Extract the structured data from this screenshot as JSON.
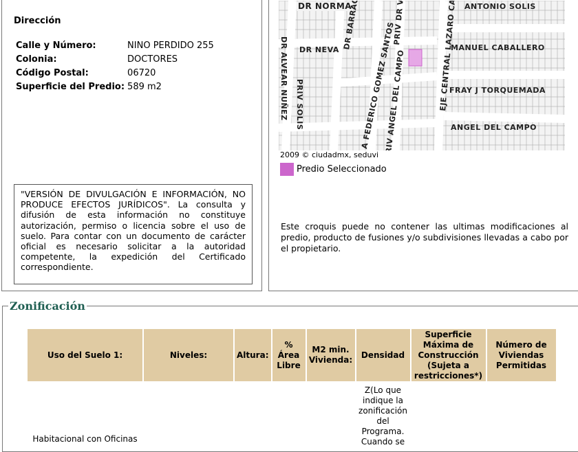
{
  "direccion": {
    "heading": "Dirección",
    "rows": [
      {
        "label": "Calle y Número:",
        "value": "NINO PERDIDO 255"
      },
      {
        "label": "Colonia:",
        "value": "DOCTORES"
      },
      {
        "label": "Código Postal:",
        "value": "06720"
      },
      {
        "label": "Superficie del Predio:",
        "value": "589 m2"
      }
    ],
    "disclaimer": "\"VERSIÓN DE DIVULGACIÓN E INFORMACIÓN, NO PRODUCE EFECTOS JURÍDICOS\". La consulta y difusión de esta información no constituye autorización, permiso o licencia sobre el uso de suelo. Para contar con un documento de carácter oficial es necesario solicitar a la autoridad competente, la expedición del Certificado correspondiente."
  },
  "map": {
    "streets": [
      "DR NORMA",
      "DR BARRAGAN",
      "PRIV DR VE",
      "EJE CENTRAL LAZARO CAR",
      "ANTONIO SOLIS",
      "DR NEVA",
      "MANUEL CABALLERO",
      "DR ALVEAR NUÑEZ",
      "PRIV SOLIS",
      "A FEDERICO GOMEZ SANTOS",
      "PRIV ANGEL DEL CAMPO",
      "FRAY J TORQUEMADA",
      "ANGEL DEL CAMPO"
    ],
    "copyright": "2009 © ciudadmx, seduvi",
    "legend_label": "Predio Seleccionado",
    "legend_color": "#cc66cc",
    "note": "Este croquis puede no contener las ultimas modificaciones al predio, producto de fusiones y/o subdivisiones llevadas a cabo por el propietario."
  },
  "zonificacion": {
    "title": "Zonificación",
    "headers": [
      "Uso del Suelo 1:",
      "Niveles:",
      "Altura:",
      "% Área Libre",
      "M2 min. Vivienda:",
      "Densidad",
      "Superficie Máxima de Construcción (Sujeta a restricciones*)",
      "Número de Viviendas Permitidas"
    ],
    "row": {
      "uso": "Habitacional con Oficinas",
      "densidad": "Z(Lo que indique la zonificación del Programa. Cuando se"
    }
  }
}
